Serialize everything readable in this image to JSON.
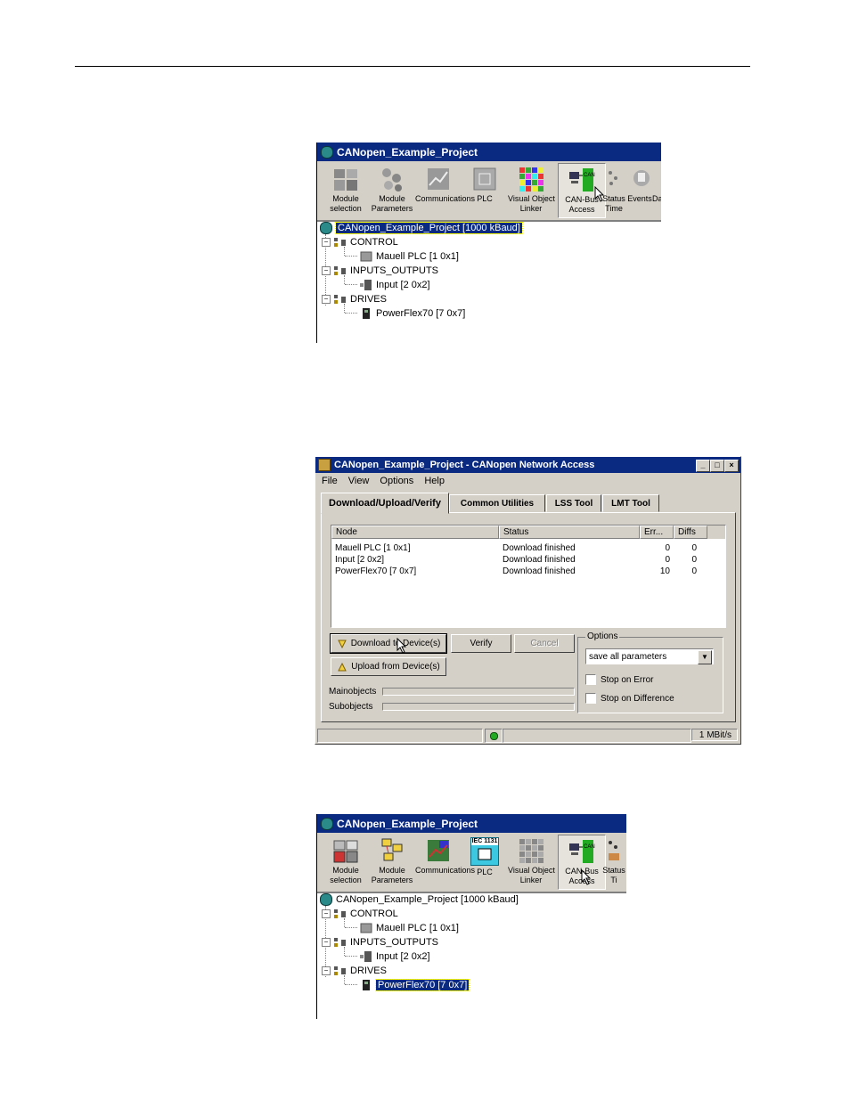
{
  "top_window": {
    "title": "CANopen_Example_Project",
    "toolbar": [
      {
        "label": "Module\nselection",
        "icon": "module-selection-icon"
      },
      {
        "label": "Module\nParameters",
        "icon": "module-parameters-icon"
      },
      {
        "label": "Communications",
        "icon": "communications-icon"
      },
      {
        "label": "PLC",
        "icon": "plc-icon"
      },
      {
        "label": "Visual Object\nLinker",
        "icon": "visual-object-linker-icon"
      },
      {
        "label": "CAN-Bus\nAccess",
        "icon": "can-bus-access-icon"
      },
      {
        "label": "Status\nTime",
        "icon": "status-icon"
      },
      {
        "label": "Events",
        "icon": "events-icon"
      },
      {
        "label": "Da",
        "icon": ""
      }
    ],
    "tree": {
      "root": "CANopen_Example_Project  [1000 kBaud]",
      "control": "CONTROL",
      "mauell": "Mauell PLC  [1  0x1]",
      "io": "INPUTS_OUTPUTS",
      "input": "Input  [2  0x2]",
      "drives": "DRIVES",
      "powerflex": "PowerFlex70  [7  0x7]"
    }
  },
  "dialog": {
    "title": "CANopen_Example_Project - CANopen Network Access",
    "menu": [
      "File",
      "View",
      "Options",
      "Help"
    ],
    "tabs": [
      "Download/Upload/Verify",
      "Common Utilities",
      "LSS Tool",
      "LMT Tool"
    ],
    "columns": [
      "Node",
      "Status",
      "Err...",
      "Diffs"
    ],
    "rows": [
      {
        "node": "Mauell PLC  [1  0x1]",
        "status": "Download finished",
        "err": "0",
        "diffs": "0"
      },
      {
        "node": "Input  [2  0x2]",
        "status": "Download finished",
        "err": "0",
        "diffs": "0"
      },
      {
        "node": "PowerFlex70  [7  0x7]",
        "status": "Download finished",
        "err": "10",
        "diffs": "0"
      }
    ],
    "buttons": {
      "download": "Download to Device(s)",
      "verify": "Verify",
      "cancel": "Cancel",
      "upload": "Upload from Device(s)"
    },
    "options": {
      "label": "Options",
      "selected": "save all parameters",
      "stop_on_error": "Stop on Error",
      "stop_on_difference": "Stop on Difference"
    },
    "progress": {
      "mainobjects": "Mainobjects",
      "subobjects": "Subobjects"
    },
    "status_bar": {
      "speed": "1 MBit/s"
    },
    "colors": {
      "titlebar": "#0a2a82",
      "face": "#d4d0c8",
      "led": "#22aa22"
    }
  },
  "bottom_window": {
    "title": "CANopen_Example_Project",
    "toolbar": [
      {
        "label": "Module\nselection",
        "icon": "module-selection-icon"
      },
      {
        "label": "Module\nParameters",
        "icon": "module-parameters-icon"
      },
      {
        "label": "Communications",
        "icon": "communications-icon"
      },
      {
        "label": "PLC",
        "icon": "plc-iec1131-icon",
        "badge": "IEC 1131"
      },
      {
        "label": "Visual Object\nLinker",
        "icon": "visual-object-linker-icon"
      },
      {
        "label": "CAN-Bus\nAccess",
        "icon": "can-bus-access-icon"
      },
      {
        "label": "Status\nTi",
        "icon": "status-icon"
      }
    ],
    "tree": {
      "root": "CANopen_Example_Project  [1000 kBaud]",
      "control": "CONTROL",
      "mauell": "Mauell PLC  [1  0x1]",
      "io": "INPUTS_OUTPUTS",
      "input": "Input  [2  0x2]",
      "drives": "DRIVES",
      "powerflex": "PowerFlex70  [7  0x7]"
    }
  }
}
